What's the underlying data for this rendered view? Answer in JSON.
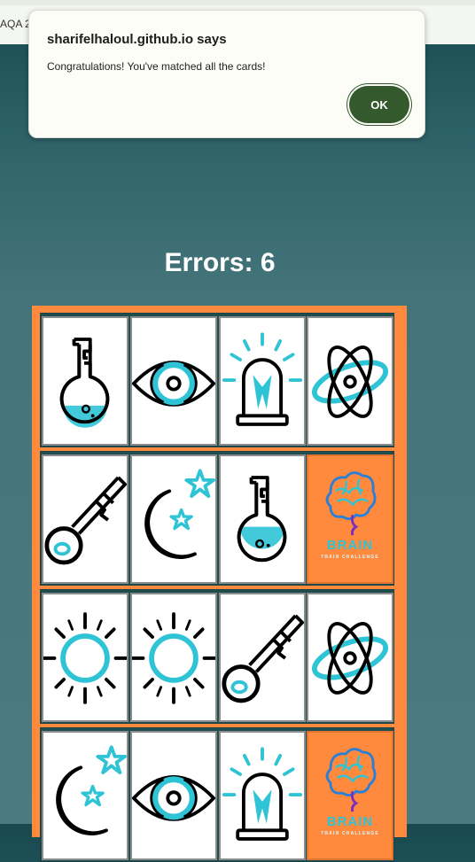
{
  "browser": {
    "tab_fragment": "AQA 2"
  },
  "dialog": {
    "title": "sharifelhaloul.github.io says",
    "message": "Congratulations! You've matched all the cards!",
    "ok_label": "OK"
  },
  "game": {
    "errors_label": "Errors: 6",
    "back_card": {
      "title": "BRAIN",
      "subtitle": "TRAIN CHALLENGE"
    },
    "rows": [
      [
        "flask",
        "eye",
        "alarm-light",
        "atom"
      ],
      [
        "key",
        "moon-stars",
        "flask",
        "card-back"
      ],
      [
        "sun",
        "sun",
        "key",
        "atom"
      ],
      [
        "moon-stars",
        "eye",
        "alarm-light",
        "card-back"
      ]
    ]
  },
  "colors": {
    "accent_cyan": "#2ec4d6",
    "board_orange": "#ff8a3d",
    "ok_green": "#33592d"
  }
}
